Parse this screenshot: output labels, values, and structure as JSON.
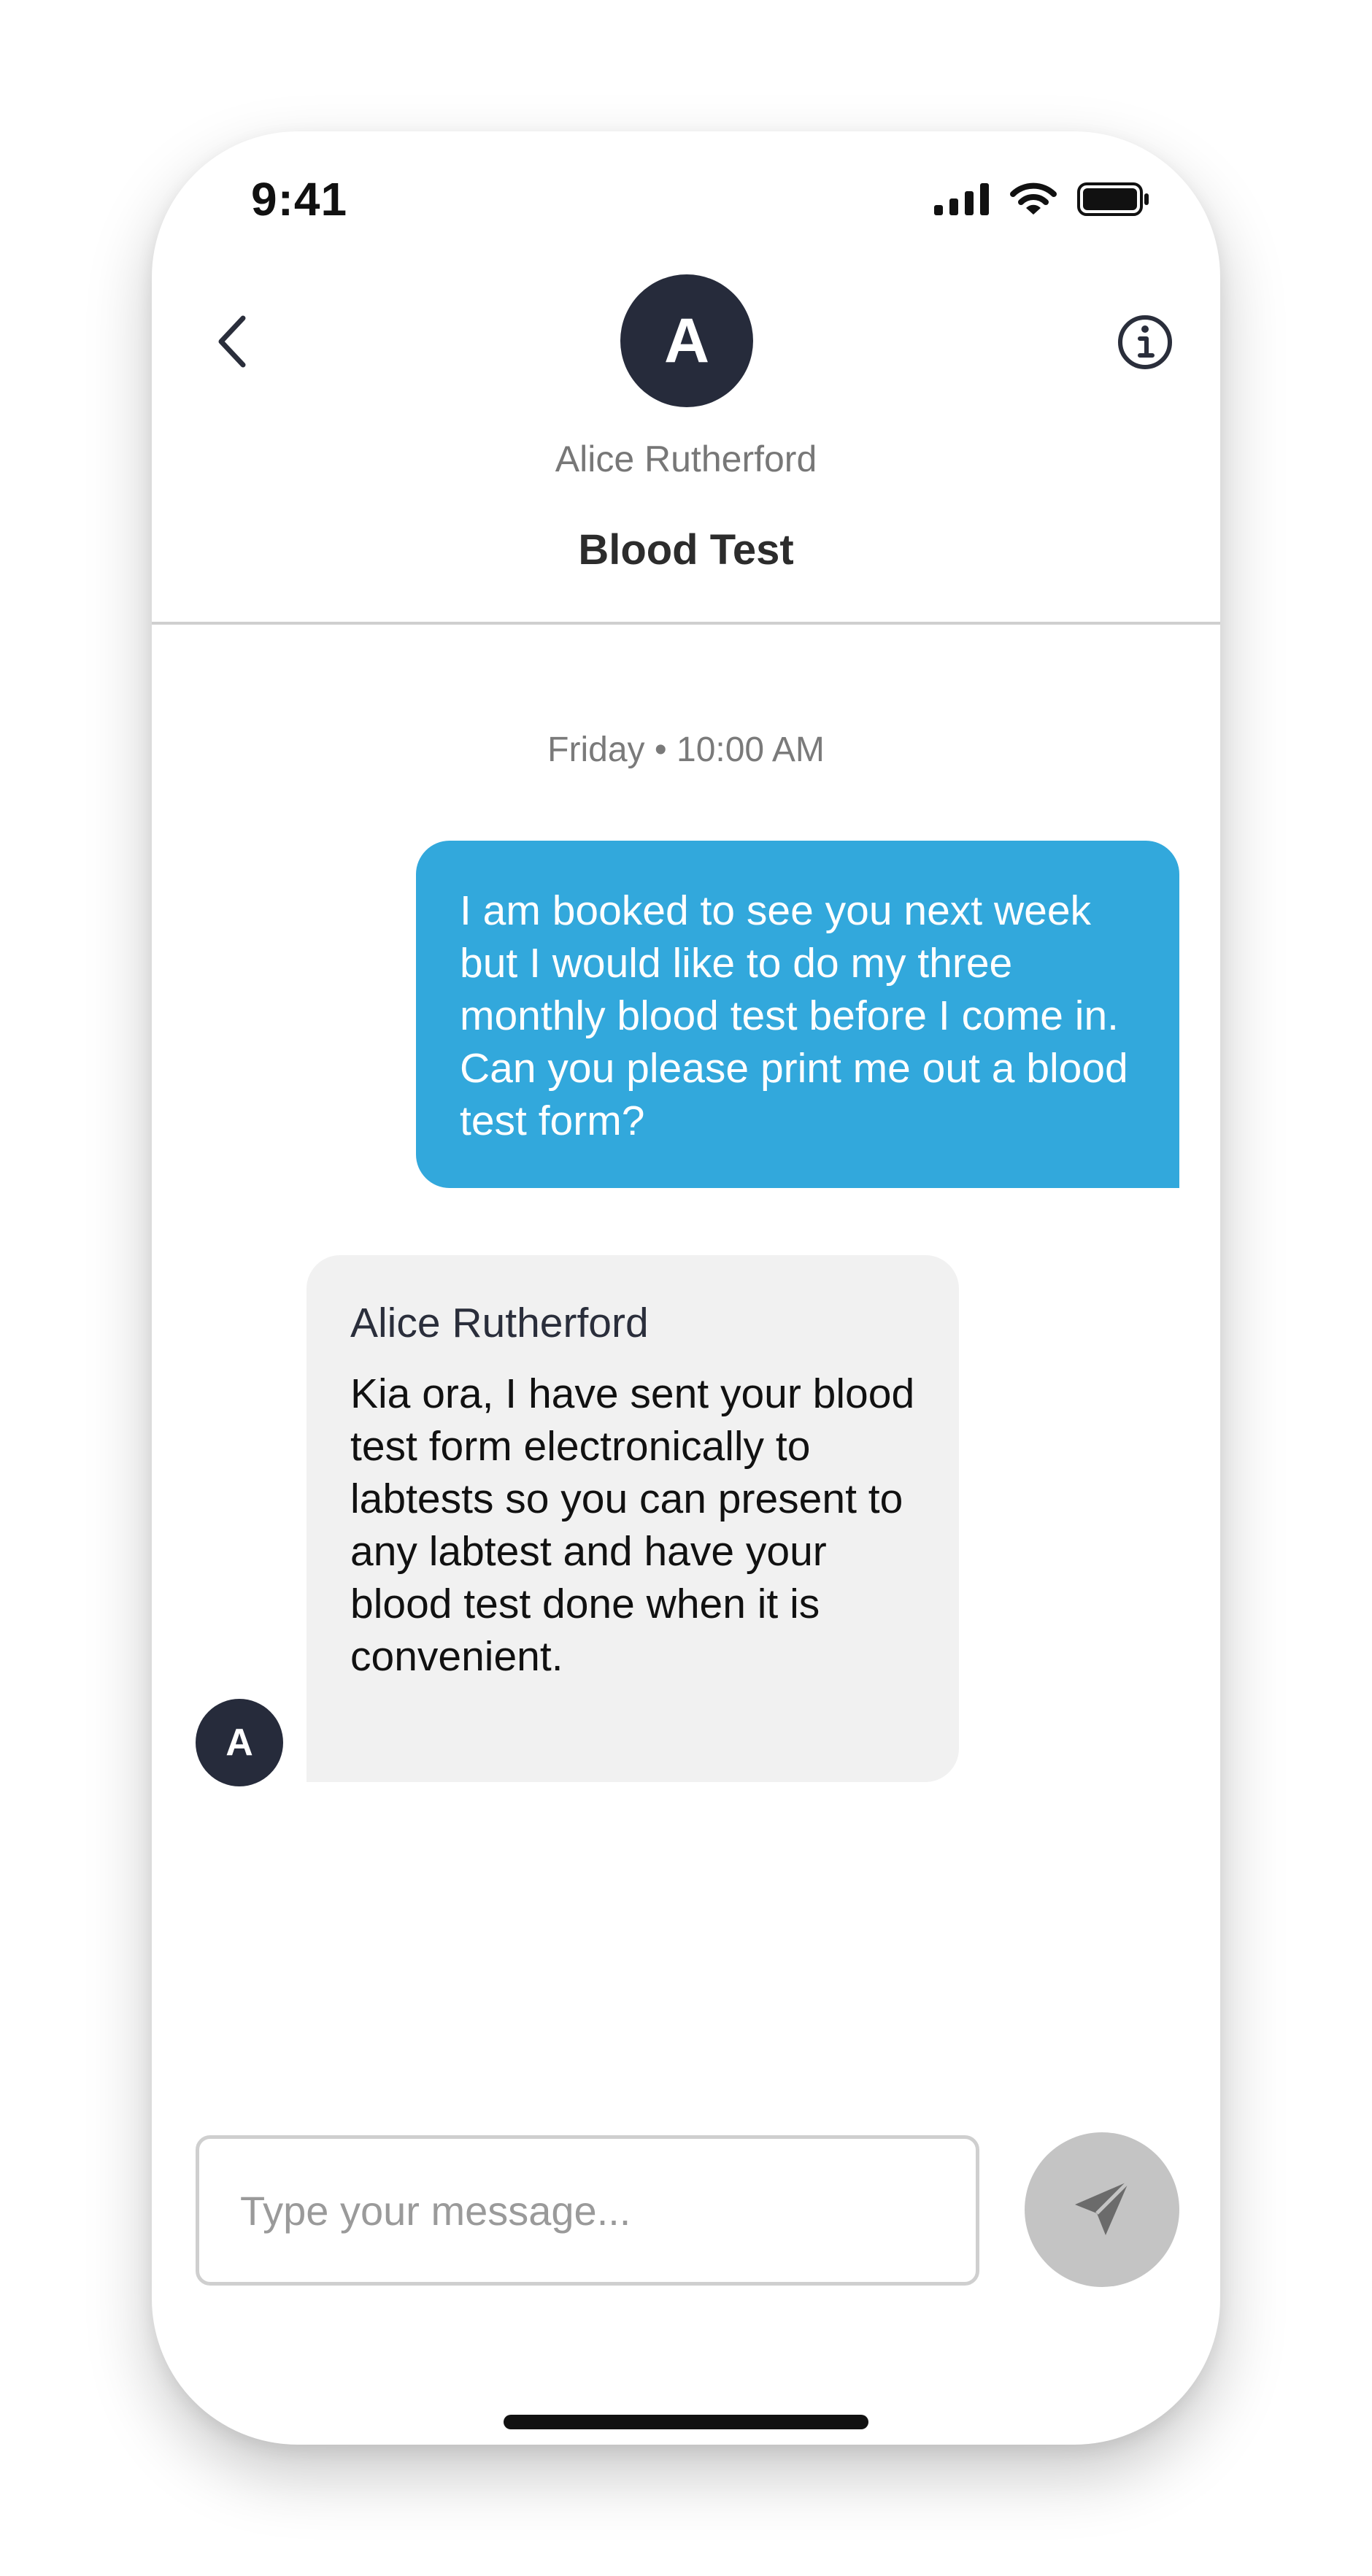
{
  "status_bar": {
    "time": "9:41",
    "icons": [
      "signal-icon",
      "wifi-icon",
      "battery-icon"
    ]
  },
  "header": {
    "back_icon": "chevron-left-icon",
    "avatar_initial": "A",
    "contact_name": "Alice Rutherford",
    "title": "Blood Test",
    "info_icon": "info-circle-icon"
  },
  "conversation": {
    "date_label": "Friday • 10:00 AM",
    "messages": [
      {
        "direction": "outgoing",
        "text": "I am booked to see you next week but I would like to do my three monthly blood test before I come in. Can you please print me out a blood test form?"
      },
      {
        "direction": "incoming",
        "sender": "Alice Rutherford",
        "avatar_initial": "A",
        "text": "Kia ora, I have sent your blood test form electronically to labtests so you can present to any labtest and have your blood test done when it is convenient."
      }
    ]
  },
  "composer": {
    "value": "",
    "placeholder": "Type your message...",
    "send_icon": "send-paper-plane-icon"
  },
  "colors": {
    "outgoing_bubble": "#32a8dc",
    "incoming_bubble": "#f1f1f1",
    "avatar_bg": "#262b3b",
    "send_button": "#c4c4c4"
  }
}
